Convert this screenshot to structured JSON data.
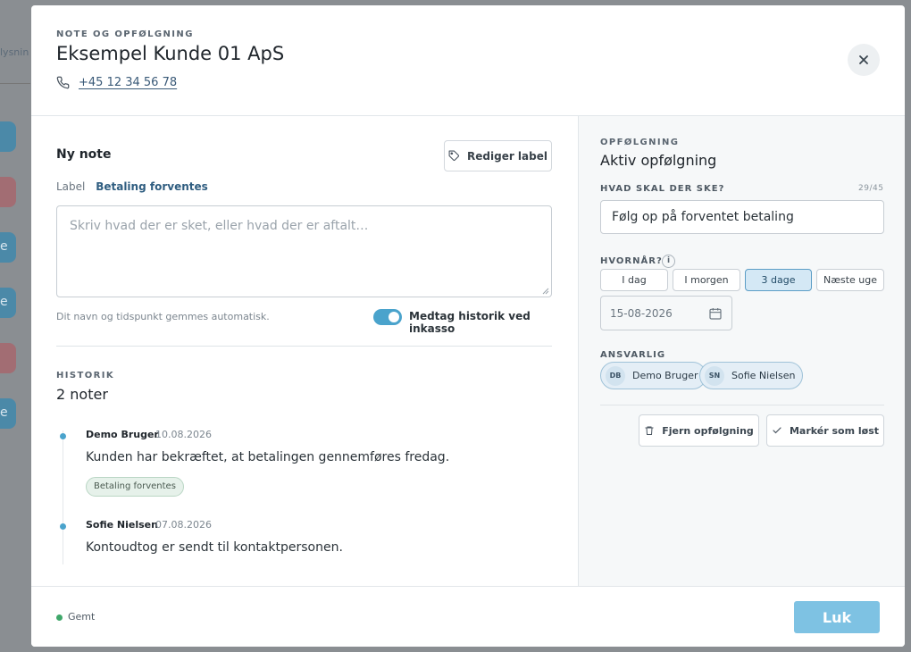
{
  "background": {
    "partial_text": "lysnin",
    "chip_glyph": "e"
  },
  "header": {
    "eyebrow": "NOTE OG OPFØLGNING",
    "title": "Eksempel Kunde 01 ApS",
    "phone": "+45 12 34 56 78",
    "close_icon": "close-icon"
  },
  "note": {
    "heading": "Ny note",
    "edit_label_button": "Rediger label",
    "label_key": "Label",
    "label_value": "Betaling forventes",
    "placeholder": "Skriv hvad der er sket, eller hvad der er aftalt…",
    "auto_save_text": "Dit navn og tidspunkt gemmes automatisk.",
    "toggle_label": "Medtag historik ved inkasso",
    "toggle_on": true
  },
  "history": {
    "eyebrow": "HISTORIK",
    "count": "2 noter",
    "entries": [
      {
        "author": "Demo Bruger",
        "date": "10.08.2026",
        "text": "Kunden har bekræftet, at betalingen gennemføres fredag.",
        "tag": "Betaling forventes"
      },
      {
        "author": "Sofie Nielsen",
        "date": "07.08.2026",
        "text": "Kontoudtog er sendt til kontaktpersonen."
      }
    ]
  },
  "followup": {
    "eyebrow": "OPFØLGNING",
    "title": "Aktiv opfølgning",
    "what_label": "HVAD SKAL DER SKE?",
    "what_counter": "29/45",
    "what_value": "Følg op på forventet betaling",
    "when_label": "HVORNÅR?",
    "info_glyph": "i",
    "when_options": [
      "I dag",
      "I morgen",
      "3 dage",
      "Næste uge"
    ],
    "when_selected": "3 dage",
    "date_value": "15-08-2026",
    "responsible_label": "ANSVARLIG",
    "responsible": [
      {
        "initials": "DB",
        "name": "Demo Bruger"
      },
      {
        "initials": "SN",
        "name": "Sofie Nielsen"
      }
    ],
    "remove_button": "Fjern opfølgning",
    "resolve_button": "Markér som løst"
  },
  "footer": {
    "status": "Gemt",
    "close_button": "Luk"
  },
  "colors": {
    "accent": "#4aa3cc",
    "primary_button": "#7ec2e3",
    "saved_status": "#3fa76a"
  }
}
